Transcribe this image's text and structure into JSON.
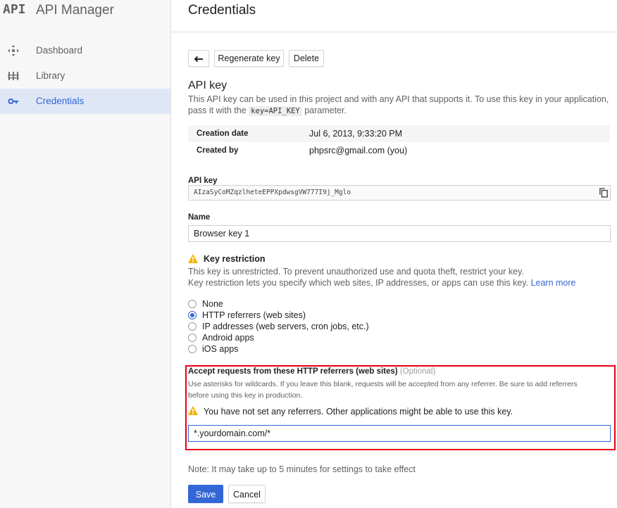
{
  "sidebar": {
    "logo": "API",
    "title": "API Manager",
    "items": [
      {
        "label": "Dashboard",
        "icon": "dashboard-icon"
      },
      {
        "label": "Library",
        "icon": "library-icon"
      },
      {
        "label": "Credentials",
        "icon": "key-icon",
        "active": true
      }
    ]
  },
  "header": {
    "title": "Credentials"
  },
  "toolbar": {
    "back_icon": "arrow-back-icon",
    "regenerate_label": "Regenerate key",
    "delete_label": "Delete"
  },
  "api_key_section": {
    "title": "API key",
    "desc_part1": "This API key can be used in this project and with any API that supports it. To use this key in your application,",
    "desc_part2_prefix": "pass it with the",
    "desc_code": "key=API_KEY",
    "desc_part2_suffix": "parameter."
  },
  "info": {
    "creation_date_label": "Creation date",
    "creation_date_value": "Jul 6, 2013, 9:33:20 PM",
    "created_by_label": "Created by",
    "created_by_value": "phpsrc@gmail.com (you)"
  },
  "api_key_field": {
    "label": "API key",
    "value": "AIzaSyCoMZqzlheteEPPXpdwsgVW777I9j_Mglo",
    "copy_icon": "copy-icon"
  },
  "name_field": {
    "label": "Name",
    "value": "Browser key 1"
  },
  "restriction": {
    "warning_icon": "warning-icon",
    "title": "Key restriction",
    "line1": "This key is unrestricted. To prevent unauthorized use and quota theft, restrict your key.",
    "line2": "Key restriction lets you specify which web sites, IP addresses, or apps can use this key.",
    "learn_more": "Learn more",
    "options": [
      {
        "label": "None",
        "selected": false
      },
      {
        "label": "HTTP referrers (web sites)",
        "selected": true
      },
      {
        "label": "IP addresses (web servers, cron jobs, etc.)",
        "selected": false
      },
      {
        "label": "Android apps",
        "selected": false
      },
      {
        "label": "iOS apps",
        "selected": false
      }
    ]
  },
  "referrers": {
    "title": "Accept requests from these HTTP referrers (web sites)",
    "optional": "(Optional)",
    "help_line1": "Use asterisks for wildcards. If you leave this blank, requests will be accepted from any referrer. Be sure to add referrers",
    "help_line2": "before using this key in production.",
    "warning": "You have not set any referrers. Other applications might be able to use this key.",
    "input_value": "*.yourdomain.com/*",
    "highlight_color": "#e60012"
  },
  "footer": {
    "note": "Note: It may take up to 5 minutes for settings to take effect",
    "save_label": "Save",
    "cancel_label": "Cancel"
  },
  "colors": {
    "accent": "#3367d6",
    "warning": "#f4b400",
    "active_nav_bg": "#dfe7f7"
  }
}
